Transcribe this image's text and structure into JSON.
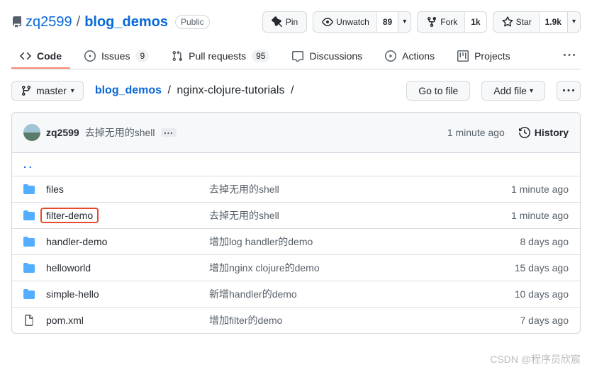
{
  "header": {
    "owner": "zq2599",
    "repo": "blog_demos",
    "visibility": "Public",
    "pin": "Pin",
    "unwatch": "Unwatch",
    "unwatch_count": "89",
    "fork": "Fork",
    "fork_count": "1k",
    "star": "Star",
    "star_count": "1.9k"
  },
  "tabs": {
    "code": "Code",
    "issues": "Issues",
    "issues_count": "9",
    "pulls": "Pull requests",
    "pulls_count": "95",
    "discussions": "Discussions",
    "actions": "Actions",
    "projects": "Projects"
  },
  "filenav": {
    "branch": "master",
    "root": "blog_demos",
    "current": "nginx-clojure-tutorials",
    "goto": "Go to file",
    "addfile": "Add file"
  },
  "commitbar": {
    "author": "zq2599",
    "message": "去掉无用的shell",
    "age": "1 minute ago",
    "history": "History"
  },
  "updir": ". .",
  "files": [
    {
      "type": "dir",
      "name": "files",
      "msg": "去掉无用的shell",
      "age": "1 minute ago",
      "highlight": false
    },
    {
      "type": "dir",
      "name": "filter-demo",
      "msg": "去掉无用的shell",
      "age": "1 minute ago",
      "highlight": true
    },
    {
      "type": "dir",
      "name": "handler-demo",
      "msg": "增加log handler的demo",
      "age": "8 days ago",
      "highlight": false
    },
    {
      "type": "dir",
      "name": "helloworld",
      "msg": "增加nginx clojure的demo",
      "age": "15 days ago",
      "highlight": false
    },
    {
      "type": "dir",
      "name": "simple-hello",
      "msg": "新增handler的demo",
      "age": "10 days ago",
      "highlight": false
    },
    {
      "type": "file",
      "name": "pom.xml",
      "msg": "增加filter的demo",
      "age": "7 days ago",
      "highlight": false
    }
  ],
  "watermark": "CSDN @程序员欣宸"
}
